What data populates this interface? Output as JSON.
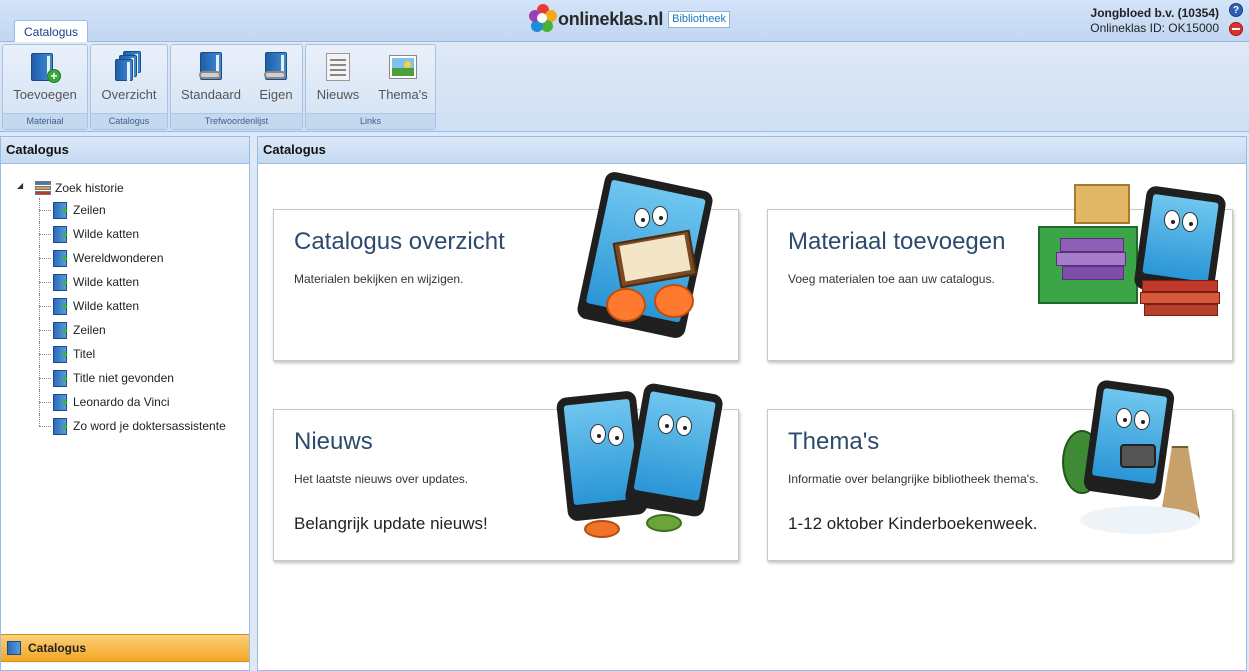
{
  "topbar": {
    "tab_label": "Catalogus",
    "brand": "onlineklas.nl",
    "brand_badge": "Bibliotheek",
    "account_name": "Jongbloed b.v. (10354)",
    "account_id": "Onlineklas ID: OK15000",
    "help_icon": "help-icon",
    "logout_icon": "logout-icon"
  },
  "ribbon": {
    "groups": [
      {
        "caption": "Materiaal",
        "buttons": [
          {
            "label": "Toevoegen",
            "icon": "book-add-icon"
          }
        ]
      },
      {
        "caption": "Catalogus",
        "buttons": [
          {
            "label": "Overzicht",
            "icon": "books-stack-icon"
          }
        ]
      },
      {
        "caption": "Trefwoordenlijst",
        "buttons": [
          {
            "label": "Standaard",
            "icon": "book-link-icon"
          },
          {
            "label": "Eigen",
            "icon": "book-link-icon"
          }
        ]
      },
      {
        "caption": "Links",
        "buttons": [
          {
            "label": "Nieuws",
            "icon": "newspaper-icon"
          },
          {
            "label": "Thema's",
            "icon": "picture-icon"
          }
        ]
      }
    ]
  },
  "left": {
    "title": "Catalogus",
    "tree_root": "Zoek historie",
    "tree_items": [
      "Zeilen",
      "Wilde katten",
      "Wereldwonderen",
      "Wilde katten",
      "Wilde katten",
      "Zeilen",
      "Titel",
      "Title niet gevonden",
      "Leonardo da Vinci",
      "Zo word je doktersassistente"
    ],
    "nav_bottom": "Catalogus"
  },
  "main": {
    "title": "Catalogus",
    "cards": [
      {
        "title": "Catalogus overzicht",
        "desc": "Materialen bekijken en wijzigen.",
        "extra": ""
      },
      {
        "title": "Materiaal toevoegen",
        "desc": "Voeg materialen toe aan uw catalogus.",
        "extra": ""
      },
      {
        "title": "Nieuws",
        "desc": "Het laatste nieuws over updates.",
        "extra": "Belangrijk update nieuws!"
      },
      {
        "title": "Thema's",
        "desc": "Informatie over belangrijke bibliotheek thema's.",
        "extra": "1-12 oktober Kinderboekenweek."
      }
    ]
  },
  "colors": {
    "accent": "#15428b",
    "panel_border": "#99bbe8",
    "nav_active": "#f5a623",
    "card_title": "#2c4a6e"
  }
}
